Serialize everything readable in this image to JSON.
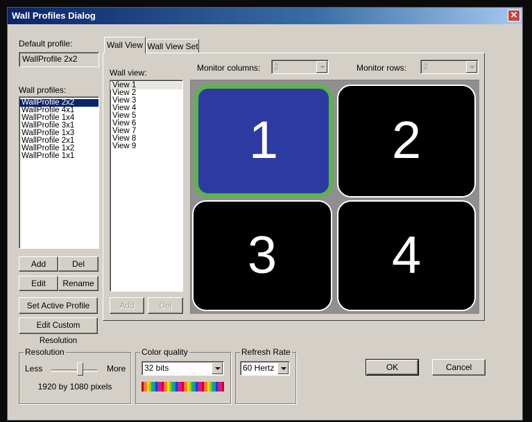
{
  "window": {
    "title": "Wall Profiles Dialog",
    "close_glyph": "✕"
  },
  "default_profile": {
    "label": "Default profile:",
    "value": "WallProfile 2x2"
  },
  "wall_profiles": {
    "label": "Wall profiles:",
    "items": [
      "WallProfile 2x2",
      "WallProfile 4x1",
      "WallProfile 1x4",
      "WallProfile 3x1",
      "WallProfile 1x3",
      "WallProfile 2x1",
      "WallProfile 1x2",
      "WallProfile 1x1"
    ],
    "selected_index": 0
  },
  "profile_buttons": {
    "add": "Add",
    "del": "Del",
    "edit": "Edit",
    "rename": "Rename",
    "set_active": "Set Active Profile",
    "edit_custom_resolution": "Edit Custom Resolution"
  },
  "tabs": {
    "wall_view": "Wall View",
    "wall_view_set": "Wall View Set"
  },
  "wall_view": {
    "label": "Wall view:",
    "items": [
      "View 1",
      "View 2",
      "View 3",
      "View 4",
      "View 5",
      "View 6",
      "View 7",
      "View 8",
      "View 9"
    ],
    "selected_index": 0,
    "add": "Add",
    "del": "Del"
  },
  "monitor_columns": {
    "label": "Monitor columns:",
    "value": "2"
  },
  "monitor_rows": {
    "label": "Monitor rows:",
    "value": "2"
  },
  "monitors": [
    "1",
    "2",
    "3",
    "4"
  ],
  "resolution": {
    "title": "Resolution",
    "less": "Less",
    "more": "More",
    "value_text": "1920 by 1080 pixels"
  },
  "color_quality": {
    "title": "Color quality",
    "value": "32 bits"
  },
  "refresh_rate": {
    "title": "Refresh Rate",
    "value": "60 Hertz"
  },
  "dialog_buttons": {
    "ok": "OK",
    "cancel": "Cancel"
  },
  "colors": {
    "title_bar": "#0a246a",
    "active_monitor": "#2d3aa2",
    "active_border": "#5cb548",
    "dialog_bg": "#d4d0c8"
  }
}
